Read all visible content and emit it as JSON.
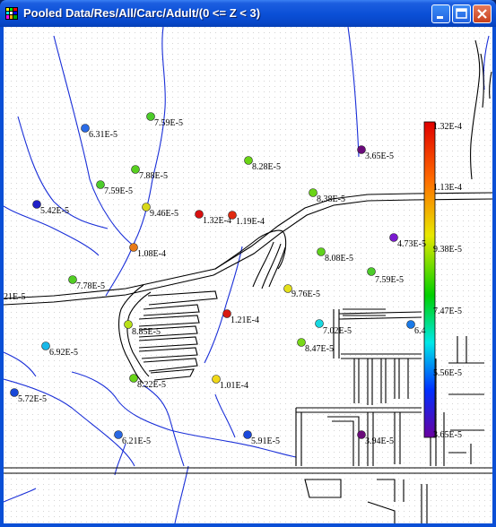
{
  "window": {
    "title": "Pooled Data/Res/All/Carc/Adult/(0 <= Z < 3)",
    "buttons": {
      "minimize": "minimize-icon",
      "maximize": "maximize-icon",
      "close": "close-icon"
    }
  },
  "colors": {
    "titlebar": "#0a4fd6",
    "stream": "#1a2fd8",
    "road": "#000000"
  },
  "scale": {
    "labels": [
      "1.32E-4",
      "1.13E-4",
      "9.38E-5",
      "7.47E-5",
      "5.56E-5",
      "3.65E-5"
    ],
    "min": 3.65e-05,
    "max": 0.000132
  },
  "points": [
    {
      "label": "6.31E-5",
      "color": "#2a6be6"
    },
    {
      "label": "7.59E-5",
      "color": "#4ccc2a"
    },
    {
      "label": "7.88E-5",
      "color": "#58d020"
    },
    {
      "label": "7.59E-5",
      "color": "#4ccc2a"
    },
    {
      "label": "8.28E-5",
      "color": "#6ad416"
    },
    {
      "label": "3.65E-5",
      "color": "#6a0a7a"
    },
    {
      "label": "5.42E-5",
      "color": "#2020c8"
    },
    {
      "label": "9.46E-5",
      "color": "#d8d81a"
    },
    {
      "label": "1.32E-4",
      "color": "#d81010"
    },
    {
      "label": "1.19E-4",
      "color": "#e02a10"
    },
    {
      "label": "8.38E-5",
      "color": "#6ad416"
    },
    {
      "label": "4.73E-5",
      "color": "#7a1ad0"
    },
    {
      "label": "1.08E-4",
      "color": "#e87a18"
    },
    {
      "label": "8.08E-5",
      "color": "#60d21c"
    },
    {
      "label": "7.78E-5",
      "color": "#52ce24"
    },
    {
      "label": "7.59E-5",
      "color": "#4ccc2a"
    },
    {
      "label": "9.76E-5",
      "color": "#e4e01c"
    },
    {
      "label": "1.21E-4",
      "color": "#d81a10"
    },
    {
      "label": "8.85E-5",
      "color": "#b8e018"
    },
    {
      "label": "7.02E-5",
      "color": "#18d8e0"
    },
    {
      "label": "6.4",
      "color": "#1a7ae8"
    },
    {
      "label": "6.92E-5",
      "color": "#18b8e8"
    },
    {
      "label": "8.47E-5",
      "color": "#78d818"
    },
    {
      "label": "5.72E-5",
      "color": "#1848d8"
    },
    {
      "label": "8.22E-5",
      "color": "#68d418"
    },
    {
      "label": "1.01E-4",
      "color": "#f0d818"
    },
    {
      "label": "6.21E-5",
      "color": "#2a68e4"
    },
    {
      "label": "5.91E-5",
      "color": "#1a48dc"
    },
    {
      "label": "3.94E-5",
      "color": "#6a0a7a"
    },
    {
      "label": "21E-5",
      "color": ""
    }
  ]
}
